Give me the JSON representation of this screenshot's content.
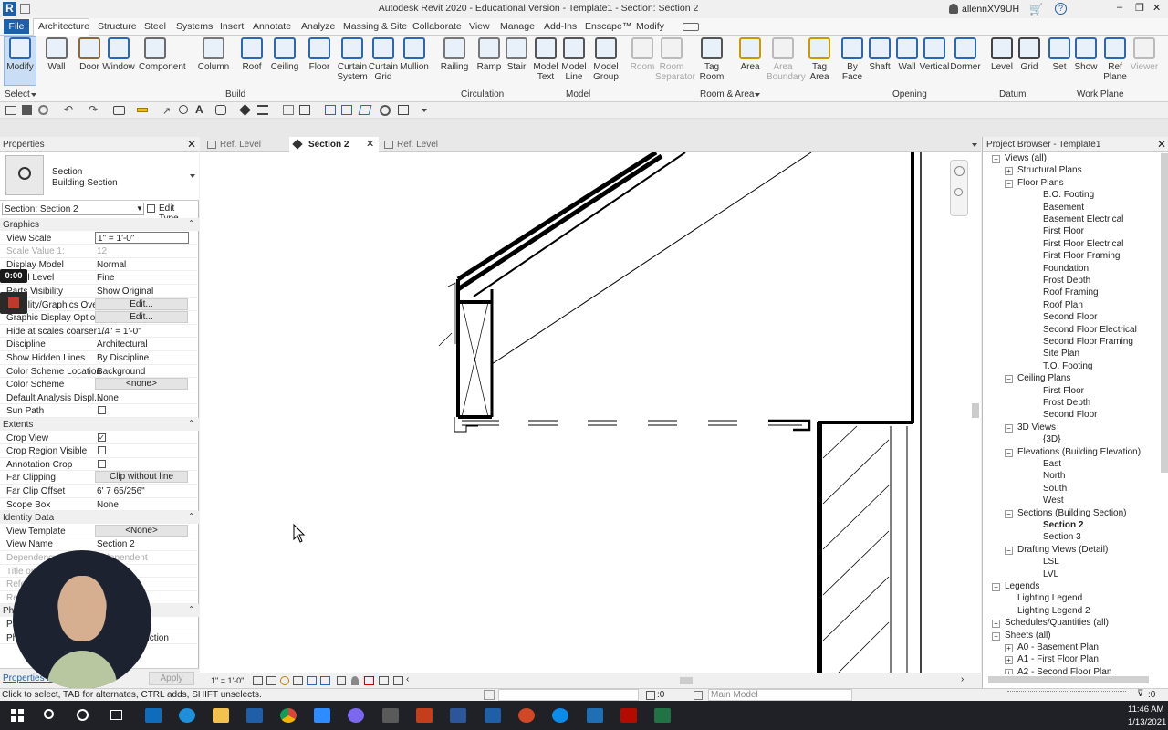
{
  "app": {
    "title": "Autodesk Revit 2020 - Educational Version - Template1 - Section: Section 2",
    "user": "allennXV9UH",
    "window_controls": [
      "–",
      "❐",
      "✕"
    ]
  },
  "menu": [
    "File",
    "Architecture",
    "Structure",
    "Steel",
    "Systems",
    "Insert",
    "Annotate",
    "Analyze",
    "Massing & Site",
    "Collaborate",
    "View",
    "Manage",
    "Add-Ins",
    "Enscape™",
    "Modify"
  ],
  "ribbon": {
    "tools": [
      {
        "label": "Modify",
        "icon": "cursor-icon"
      },
      {
        "label": "Wall",
        "icon": "wall-icon"
      },
      {
        "label": "Door",
        "icon": "door-icon"
      },
      {
        "label": "Window",
        "icon": "window-icon"
      },
      {
        "label": "Component",
        "icon": "component-icon"
      },
      {
        "label": "Column",
        "icon": "column-icon"
      },
      {
        "label": "Roof",
        "icon": "roof-icon"
      },
      {
        "label": "Ceiling",
        "icon": "ceiling-icon"
      },
      {
        "label": "Floor",
        "icon": "floor-icon"
      },
      {
        "label": "Curtain\nSystem",
        "icon": "curtain-system-icon"
      },
      {
        "label": "Curtain\nGrid",
        "icon": "curtain-grid-icon"
      },
      {
        "label": "Mullion",
        "icon": "mullion-icon"
      },
      {
        "label": "Railing",
        "icon": "railing-icon"
      },
      {
        "label": "Ramp",
        "icon": "ramp-icon"
      },
      {
        "label": "Stair",
        "icon": "stair-icon"
      },
      {
        "label": "Model\nText",
        "icon": "model-text-icon"
      },
      {
        "label": "Model\nLine",
        "icon": "model-line-icon"
      },
      {
        "label": "Model\nGroup",
        "icon": "model-group-icon"
      },
      {
        "label": "Room",
        "icon": "room-icon"
      },
      {
        "label": "Room\nSeparator",
        "icon": "room-separator-icon"
      },
      {
        "label": "Tag\nRoom",
        "icon": "tag-room-icon"
      },
      {
        "label": "Area",
        "icon": "area-icon"
      },
      {
        "label": "Area\nBoundary",
        "icon": "area-boundary-icon"
      },
      {
        "label": "Tag\nArea",
        "icon": "tag-area-icon"
      },
      {
        "label": "By\nFace",
        "icon": "by-face-icon"
      },
      {
        "label": "Shaft",
        "icon": "shaft-icon"
      },
      {
        "label": "Wall",
        "icon": "wall-opening-icon"
      },
      {
        "label": "Vertical",
        "icon": "vertical-icon"
      },
      {
        "label": "Dormer",
        "icon": "dormer-icon"
      },
      {
        "label": "Level",
        "icon": "level-icon"
      },
      {
        "label": "Grid",
        "icon": "grid-icon"
      },
      {
        "label": "Set",
        "icon": "set-icon"
      },
      {
        "label": "Show",
        "icon": "show-icon"
      },
      {
        "label": "Ref\nPlane",
        "icon": "ref-plane-icon"
      },
      {
        "label": "Viewer",
        "icon": "viewer-icon"
      }
    ],
    "groups": [
      "Select",
      "Build",
      "Circulation",
      "Model",
      "Room & Area",
      "Opening",
      "Datum",
      "Work Plane"
    ]
  },
  "tabs": [
    {
      "label": "Ref. Level"
    },
    {
      "label": "Section 2"
    },
    {
      "label": "Ref. Level"
    }
  ],
  "properties": {
    "header": "Properties",
    "type_line1": "Section",
    "type_line2": "Building Section",
    "selector": "Section: Section 2",
    "edit_type": "Edit Type",
    "sections": [
      {
        "title": "Graphics",
        "rows": [
          [
            "View Scale",
            "1\" = 1'-0\""
          ],
          [
            "Scale Value    1:",
            "12"
          ],
          [
            "Display Model",
            "Normal"
          ],
          [
            "Detail Level",
            "Fine"
          ],
          [
            "Parts Visibility",
            "Show Original"
          ],
          [
            "Visibility/Graphics Ove...",
            "Edit..."
          ],
          [
            "Graphic Display Optio...",
            "Edit..."
          ],
          [
            "Hide at scales coarser ...",
            "1/4\" = 1'-0\""
          ],
          [
            "Discipline",
            "Architectural"
          ],
          [
            "Show Hidden Lines",
            "By Discipline"
          ],
          [
            "Color Scheme Location",
            "Background"
          ],
          [
            "Color Scheme",
            "<none>"
          ],
          [
            "Default Analysis Displ...",
            "None"
          ],
          [
            "Sun Path",
            ""
          ]
        ]
      },
      {
        "title": "Extents",
        "rows": [
          [
            "Crop View",
            ""
          ],
          [
            "Crop Region Visible",
            ""
          ],
          [
            "Annotation Crop",
            ""
          ],
          [
            "Far Clipping",
            "Clip without line"
          ],
          [
            "Far Clip Offset",
            "6'  7 65/256\""
          ],
          [
            "Scope Box",
            "None"
          ]
        ]
      },
      {
        "title": "Identity Data",
        "rows": [
          [
            "View Template",
            "<None>"
          ],
          [
            "View Name",
            "Section 2"
          ],
          [
            "Dependency",
            "Independent"
          ],
          [
            "Title on Sheet",
            ""
          ],
          [
            "Referencing Sheet",
            ""
          ],
          [
            "Referencing Detail",
            ""
          ]
        ]
      },
      {
        "title": "Phasing",
        "rows": [
          [
            "Phase Filter",
            ""
          ],
          [
            "Phase",
            "New Construction"
          ]
        ]
      }
    ],
    "help_link": "Properties help",
    "apply": "Apply"
  },
  "recording": {
    "time": "0:00"
  },
  "project_browser": {
    "title": "Project Browser - Template1",
    "items": [
      {
        "t": "Views (all)",
        "d": 0,
        "exp": "−"
      },
      {
        "t": "Structural Plans",
        "d": 1,
        "exp": "+"
      },
      {
        "t": "Floor Plans",
        "d": 1,
        "exp": "−"
      },
      {
        "t": "B.O. Footing",
        "d": 2
      },
      {
        "t": "Basement",
        "d": 2
      },
      {
        "t": "Basement Electrical",
        "d": 2
      },
      {
        "t": "First Floor",
        "d": 2
      },
      {
        "t": "First Floor Electrical",
        "d": 2
      },
      {
        "t": "First Floor Framing",
        "d": 2
      },
      {
        "t": "Foundation",
        "d": 2
      },
      {
        "t": "Frost Depth",
        "d": 2
      },
      {
        "t": "Roof Framing",
        "d": 2
      },
      {
        "t": "Roof Plan",
        "d": 2
      },
      {
        "t": "Second Floor",
        "d": 2
      },
      {
        "t": "Second Floor Electrical",
        "d": 2
      },
      {
        "t": "Second Floor Framing",
        "d": 2
      },
      {
        "t": "Site Plan",
        "d": 2
      },
      {
        "t": "T.O. Footing",
        "d": 2
      },
      {
        "t": "Ceiling Plans",
        "d": 1,
        "exp": "−"
      },
      {
        "t": "First Floor",
        "d": 2
      },
      {
        "t": "Frost Depth",
        "d": 2
      },
      {
        "t": "Second Floor",
        "d": 2
      },
      {
        "t": "3D Views",
        "d": 1,
        "exp": "−"
      },
      {
        "t": "{3D}",
        "d": 2
      },
      {
        "t": "Elevations (Building Elevation)",
        "d": 1,
        "exp": "−"
      },
      {
        "t": "East",
        "d": 2
      },
      {
        "t": "North",
        "d": 2
      },
      {
        "t": "South",
        "d": 2
      },
      {
        "t": "West",
        "d": 2
      },
      {
        "t": "Sections (Building Section)",
        "d": 1,
        "exp": "−"
      },
      {
        "t": "Section 2",
        "d": 2,
        "bold": true
      },
      {
        "t": "Section 3",
        "d": 2
      },
      {
        "t": "Drafting Views (Detail)",
        "d": 1,
        "exp": "−"
      },
      {
        "t": "LSL",
        "d": 2
      },
      {
        "t": "LVL",
        "d": 2
      },
      {
        "t": "Legends",
        "d": 0,
        "exp": "−"
      },
      {
        "t": "Lighting Legend",
        "d": 1
      },
      {
        "t": "Lighting Legend 2",
        "d": 1
      },
      {
        "t": "Schedules/Quantities (all)",
        "d": 0,
        "exp": "+"
      },
      {
        "t": "Sheets (all)",
        "d": 0,
        "exp": "−"
      },
      {
        "t": "A0 - Basement Plan",
        "d": 1,
        "exp": "+"
      },
      {
        "t": "A1 - First Floor Plan",
        "d": 1,
        "exp": "+"
      },
      {
        "t": "A2 - Second Floor Plan",
        "d": 1,
        "exp": "+"
      }
    ]
  },
  "view_control": {
    "scale": "1\" = 1'-0\""
  },
  "status": {
    "hint": "Click to select, TAB for alternates, CTRL adds, SHIFT unselects.",
    "workset": ":0",
    "model": "Main Model"
  },
  "clock": {
    "time": "11:46 AM",
    "date": "1/13/2021"
  }
}
